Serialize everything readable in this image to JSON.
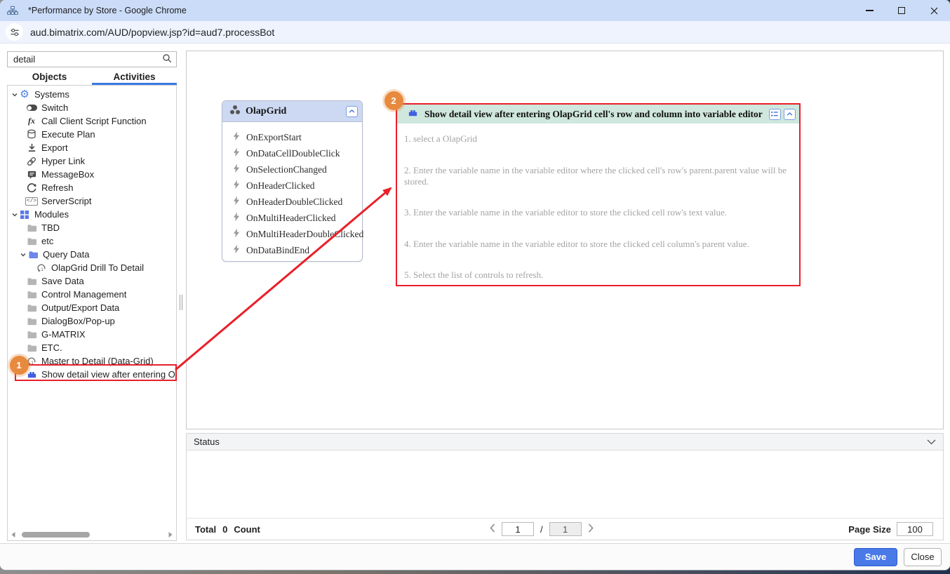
{
  "window": {
    "title": "*Performance by Store - Google Chrome",
    "url": "aud.bimatrix.com/AUD/popview.jsp?id=aud7.processBot"
  },
  "sidebar": {
    "search": {
      "value": "detail"
    },
    "tabs": [
      {
        "label": "Objects"
      },
      {
        "label": "Activities"
      }
    ],
    "active_tab": "Activities",
    "tree": [
      "Systems",
      "Switch",
      "Call Client Script Function",
      "Execute Plan",
      "Export",
      "Hyper Link",
      "MessageBox",
      "Refresh",
      "ServerScript",
      "Modules",
      "TBD",
      "etc",
      "Query Data",
      "OlapGrid Drill To Detail",
      "Save Data",
      "Control Management",
      "Output/Export Data",
      "DialogBox/Pop-up",
      "G-MATRIX",
      "ETC.",
      "Master to Detail (Data-Grid)",
      "Show detail view after entering Ol"
    ]
  },
  "canvas": {
    "olapgrid": {
      "title": "OlapGrid",
      "events": [
        "OnExportStart",
        "OnDataCellDoubleClick",
        "OnSelectionChanged",
        "OnHeaderClicked",
        "OnHeaderDoubleClicked",
        "OnMultiHeaderClicked",
        "OnMultiHeaderDoubleClicked",
        "OnDataBindEnd"
      ]
    },
    "detail": {
      "title": "Show detail view after entering OlapGrid cell's row and column into variable editor",
      "steps": [
        "1. select a OlapGrid",
        "2. Enter the variable name in the variable editor where the clicked cell's row's parent.parent value will be stored.",
        "3. Enter the variable name in the variable editor to store the clicked cell row's text value.",
        "4. Enter the variable name in the variable editor to store the clicked cell column's parent value.",
        "5. Select the list of controls to refresh."
      ]
    },
    "annotations": {
      "one": "1",
      "two": "2"
    }
  },
  "status": {
    "label": "Status"
  },
  "pagination": {
    "total_label": "Total",
    "count_value": "0",
    "count_label": "Count",
    "current_page": "1",
    "total_pages": "1",
    "page_size_label": "Page Size",
    "page_size_value": "100"
  },
  "footer": {
    "save_label": "Save",
    "close_label": "Close"
  },
  "colors": {
    "accent_blue": "#4a79e8",
    "annotation_red": "#e8202a",
    "annotation_orange": "#e88a3e",
    "detail_header_green": "#cfe7dd",
    "olapgrid_header_blue": "#cdd9f2",
    "tab_underline": "#3c7ae4",
    "titlebar_blue": "#cbdcf8"
  }
}
